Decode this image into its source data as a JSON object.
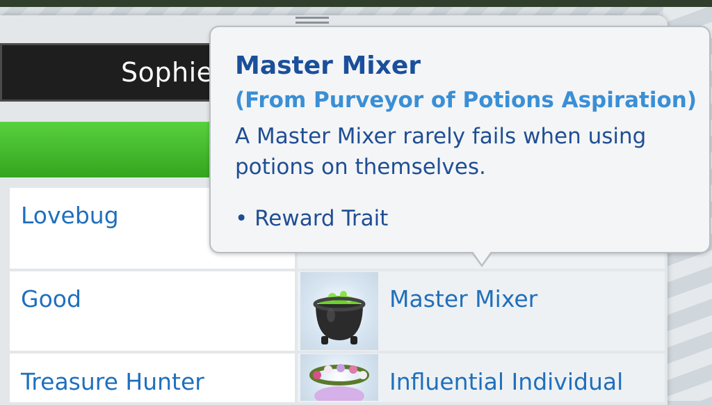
{
  "sim": {
    "name": "Sophie"
  },
  "tooltip": {
    "title": "Master Mixer",
    "source": "(From Purveyor of Potions Aspiration)",
    "description": "A Master Mixer rarely fails when using potions on themselves.",
    "bullet": "• Reward Trait"
  },
  "traits": {
    "left": [
      "Lovebug",
      "Good",
      "Treasure Hunter"
    ],
    "right": [
      "",
      "Master Mixer",
      "Influential Individual"
    ]
  },
  "icons": {
    "row2_right": "cauldron-icon",
    "row3_right": "flower-crown-icon"
  },
  "colors": {
    "trait_text": "#1f6fbd",
    "tooltip_title": "#1a4f9b",
    "tooltip_source": "#3a8fd6",
    "progress_green": "#44bb2a"
  }
}
